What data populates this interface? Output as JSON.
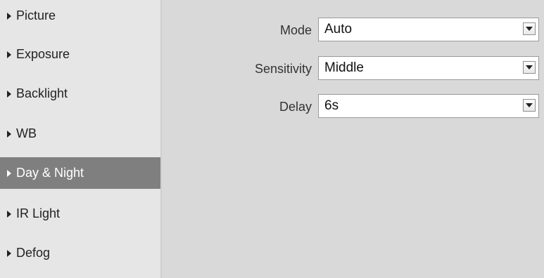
{
  "sidebar": {
    "items": [
      {
        "label": "Picture",
        "active": false
      },
      {
        "label": "Exposure",
        "active": false
      },
      {
        "label": "Backlight",
        "active": false
      },
      {
        "label": "WB",
        "active": false
      },
      {
        "label": "Day & Night",
        "active": true
      },
      {
        "label": "IR Light",
        "active": false
      },
      {
        "label": "Defog",
        "active": false
      }
    ]
  },
  "form": {
    "mode": {
      "label": "Mode",
      "value": "Auto"
    },
    "sensitivity": {
      "label": "Sensitivity",
      "value": "Middle"
    },
    "delay": {
      "label": "Delay",
      "value": "6s"
    }
  },
  "colors": {
    "active_item_bg": "#7f7f7f",
    "sidebar_bg": "#e6e6e6",
    "content_bg": "#d9d9d9"
  }
}
